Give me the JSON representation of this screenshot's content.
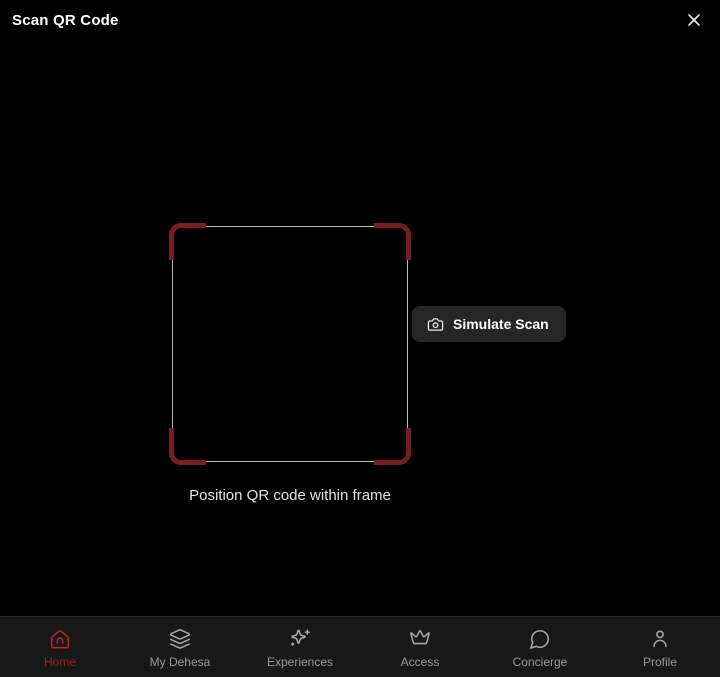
{
  "header": {
    "title": "Scan QR Code",
    "close_icon": "close-icon"
  },
  "scanner": {
    "caption": "Position QR code within frame",
    "simulate_button": {
      "label": "Simulate Scan",
      "icon": "camera-icon"
    }
  },
  "nav": {
    "items": [
      {
        "label": "Home",
        "icon": "home-icon",
        "active": true
      },
      {
        "label": "My Dehesa",
        "icon": "layers-icon",
        "active": false
      },
      {
        "label": "Experiences",
        "icon": "sparkles-icon",
        "active": false
      },
      {
        "label": "Access",
        "icon": "crown-icon",
        "active": false
      },
      {
        "label": "Concierge",
        "icon": "chat-bubble-icon",
        "active": false
      },
      {
        "label": "Profile",
        "icon": "person-icon",
        "active": false
      }
    ]
  },
  "colors": {
    "accent": "#b42727",
    "accent_label": "#971f1f",
    "accent_dark": "#7a1d1d",
    "background": "#000000",
    "nav_background": "#181818",
    "frame_line": "#b9b9b9",
    "button_background": "#262626"
  }
}
